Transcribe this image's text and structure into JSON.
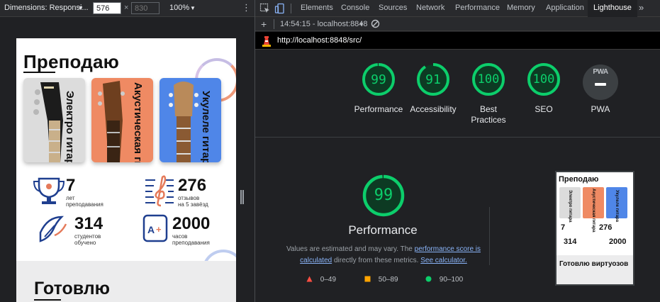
{
  "device_toolbar": {
    "dimensions_label": "Dimensions: Responsi...",
    "width_value": "576",
    "height_placeholder": "830",
    "times": "×",
    "zoom": "100%"
  },
  "page": {
    "section_title": "Преподаю",
    "cards": [
      {
        "label": "Электро гитара",
        "color": "#dcdcdc"
      },
      {
        "label": "Акустическая гитара",
        "color": "#ef8a63"
      },
      {
        "label": "Укулеле гитара",
        "color": "#4f86e8"
      }
    ],
    "stats": [
      {
        "number": "7",
        "line1": "лет",
        "line2": "преподавания"
      },
      {
        "number": "276",
        "line1": "отзывов",
        "line2": "на 5 завёзд"
      },
      {
        "number": "314",
        "line1": "студентов",
        "line2": "обучено"
      },
      {
        "number": "2000",
        "line1": "часов",
        "line2": "преподавания"
      }
    ],
    "section2_title": "Готовлю"
  },
  "devtools": {
    "tabs": [
      "Elements",
      "Console",
      "Sources",
      "Network",
      "Performance",
      "Memory",
      "Application",
      "Lighthouse"
    ],
    "active_tab": "Lighthouse",
    "more_tabs": "»",
    "add": "+",
    "report_time": "14:54:15 - localhost:8848",
    "url": "http://localhost:8848/src/"
  },
  "lighthouse": {
    "scores": [
      {
        "value": "99",
        "label": "Performance"
      },
      {
        "value": "91",
        "label": "Accessibility"
      },
      {
        "value": "100",
        "label": "Best Practices"
      },
      {
        "value": "100",
        "label": "SEO"
      },
      {
        "value": "PWA",
        "label": "PWA"
      }
    ],
    "score_fractions": [
      0.99,
      0.91,
      1.0,
      1.0
    ],
    "big_score": "99",
    "big_title": "Performance",
    "desc_prefix": "Values are estimated and may vary. The ",
    "desc_link1": "performance score is calculated",
    "desc_middle": " directly from these metrics. ",
    "desc_link2": "See calculator.",
    "legend": [
      {
        "range": "0–49",
        "color": "#ff4e42"
      },
      {
        "range": "50–89",
        "color": "#ffa400"
      },
      {
        "range": "90–100",
        "color": "#0cce6b"
      }
    ],
    "thumbnail": {
      "title": "Преподаю",
      "card1": "Электро гитара",
      "card2": "Акустическая гитара",
      "card3": "Укулеле гитара",
      "stat1": "7",
      "stat2": "276",
      "stat3": "314",
      "stat4": "2000",
      "title2": "Готовлю виртуозов"
    }
  },
  "colors": {
    "good": "#0cce6b",
    "good_fill": "#0d3a23",
    "link": "#8ab4f8"
  }
}
